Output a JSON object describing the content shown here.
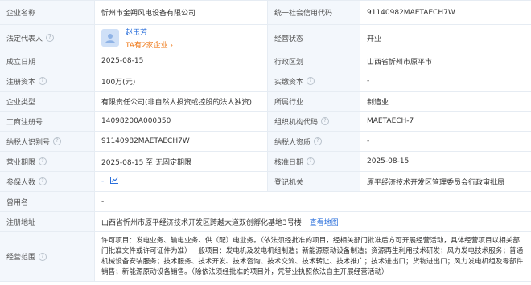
{
  "rows": {
    "r1": {
      "l1": "企业名称",
      "v1": "忻州市金朔风电设备有限公司",
      "l2": "统一社会信用代码",
      "v2": "91140982MAETAECH7W"
    },
    "r2": {
      "l1": "法定代表人",
      "person_name": "赵玉芳",
      "person_count": "TA有2家企业 ›",
      "l2": "经营状态",
      "v2": "开业"
    },
    "r3": {
      "l1": "成立日期",
      "v1": "2025-08-15",
      "l2": "行政区划",
      "v2": "山西省忻州市原平市"
    },
    "r4": {
      "l1": "注册资本",
      "v1": "100万(元)",
      "l2": "实缴资本",
      "v2": "-"
    },
    "r5": {
      "l1": "企业类型",
      "v1": "有限责任公司(非自然人投资或控股的法人独资)",
      "l2": "所属行业",
      "v2": "制造业"
    },
    "r6": {
      "l1": "工商注册号",
      "v1": "14098200A000350",
      "l2": "组织机构代码",
      "v2": "MAETAECH-7"
    },
    "r7": {
      "l1": "纳税人识别号",
      "v1": "91140982MAETAECH7W",
      "l2": "纳税人资质",
      "v2": "-"
    },
    "r8": {
      "l1": "营业期限",
      "v1": "2025-08-15 至 无固定期限",
      "l2": "核准日期",
      "v2": "2025-08-15"
    },
    "r9": {
      "l1": "参保人数",
      "v1": "-",
      "l2": "登记机关",
      "v2": "原平经济技术开发区管理委员会行政审批局"
    },
    "r10": {
      "l1": "曾用名",
      "v1": "-"
    },
    "r11": {
      "l1": "注册地址",
      "v1": "山西省忻州市原平经济技术开发区跨越大道双创孵化基地3号楼",
      "map": "查看地图"
    },
    "r12": {
      "l1": "经营范围",
      "v1": "许可项目：发电业务、输电业务、供（配）电业务。（依法须经批准的项目，经相关部门批准后方可开展经营活动，具体经营项目以相关部门批准文件或许可证件为准）一般项目：发电机及发电机组制造；新能源原动设备制造；资源再生利用技术研发；风力发电技术服务；普通机械设备安装服务；技术服务、技术开发、技术咨询、技术交流、技术转让、技术推广；技术进出口；货物进出口；风力发电机组及零部件销售；新能源原动设备销售。（除依法须经批准的项目外，凭营业执照依法自主开展经营活动）"
    }
  },
  "icons": {
    "help": "question-circle-icon",
    "trend": "trend-chart-icon",
    "avatar": "person-avatar-icon"
  },
  "colors": {
    "label_bg": "#f3f7fc",
    "border": "#e6ecf3",
    "link": "#2a6fdb",
    "accent": "#ef7a1a"
  }
}
